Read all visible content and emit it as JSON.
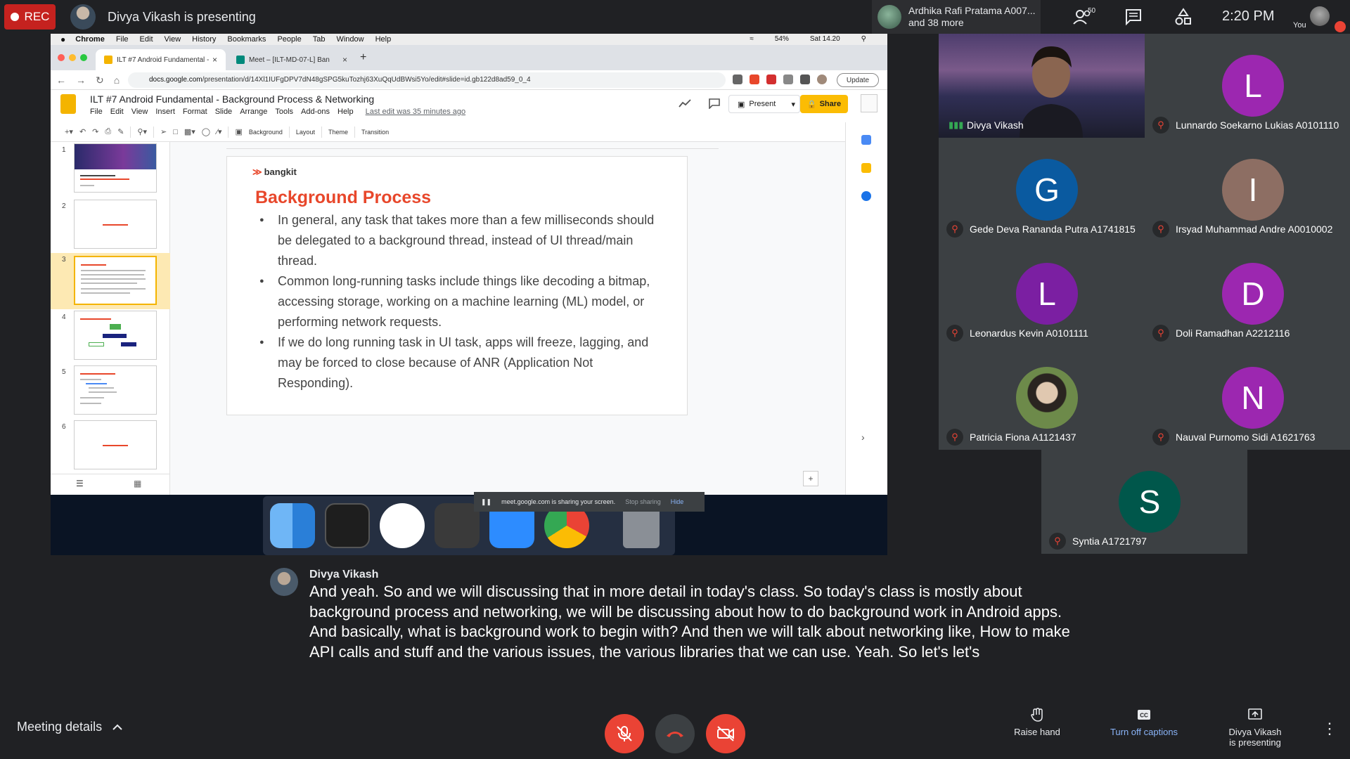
{
  "topbar": {
    "rec_label": "REC",
    "presenter_title": "Divya Vikash is presenting",
    "participant_pill_line1": "Ardhika Rafi Pratama A007...",
    "participant_pill_line2": "and 38 more",
    "people_count": "50",
    "clock": "2:20 PM",
    "self_label": "You"
  },
  "mac_menubar": {
    "app": "Chrome",
    "items": [
      "File",
      "Edit",
      "View",
      "History",
      "Bookmarks",
      "People",
      "Tab",
      "Window",
      "Help"
    ],
    "battery": "54%",
    "datetime": "Sat 14.20"
  },
  "browser": {
    "tabs": [
      {
        "label": "ILT #7 Android Fundamental -"
      },
      {
        "label": "Meet – [ILT-MD-07-L] Ban"
      }
    ],
    "url_host": "docs.google.com",
    "url_path": "/presentation/d/14Xl1IUFgDPV7dN48gSPG5kuTozhj63XuQqUdBWsi5Yo/edit#slide=id.gb122d8ad59_0_4",
    "update_label": "Update"
  },
  "slides_app": {
    "doc_title": "ILT #7 Android Fundamental - Background Process & Networking",
    "menu": [
      "File",
      "Edit",
      "View",
      "Insert",
      "Format",
      "Slide",
      "Arrange",
      "Tools",
      "Add-ons",
      "Help"
    ],
    "last_edit": "Last edit was 35 minutes ago",
    "present_label": "Present",
    "share_label": "Share",
    "toolbar": [
      "Background",
      "Layout",
      "Theme",
      "Transition"
    ],
    "thumbnails": [
      "1",
      "2",
      "3",
      "4",
      "5",
      "6"
    ],
    "selected_thumbnail": 3
  },
  "slide": {
    "logo_text": "bangkit",
    "title": "Background Process",
    "bullets": [
      "In general, any task that takes more than a few milliseconds should be delegated to a background thread, instead of UI thread/main thread.",
      "Common long-running tasks include things like decoding a bitmap, accessing storage, working on a machine learning (ML) model, or performing network requests.",
      "If we do long running task in UI task, apps will freeze, lagging, and may be forced to close because of ANR (Application Not Responding)."
    ],
    "title_color": "#e8472b"
  },
  "share_notice": {
    "text": "meet.google.com is sharing your screen.",
    "stop_label": "Stop sharing",
    "hide_label": "Hide"
  },
  "participants": [
    {
      "name": "Divya Vikash",
      "initial": "",
      "color": "",
      "video": true
    },
    {
      "name": "Lunnardo Soekarno Lukias A0101110",
      "initial": "L",
      "color": "#9c27b0"
    },
    {
      "name": "Gede Deva Rananda Putra A1741815",
      "initial": "G",
      "color": "#0a5aa0"
    },
    {
      "name": "Irsyad Muhammad Andre A0010002",
      "initial": "I",
      "color": "#8d6e63"
    },
    {
      "name": "Leonardus Kevin A0101111",
      "initial": "L",
      "color": "#7b1fa2"
    },
    {
      "name": "Doli Ramadhan A2212116",
      "initial": "D",
      "color": "#9c27b0"
    },
    {
      "name": "Patricia Fiona A1121437",
      "initial": "",
      "color": "#6d8a4a"
    },
    {
      "name": "Nauval Purnomo Sidi A1621763",
      "initial": "N",
      "color": "#9c27b0"
    },
    {
      "name": "Syntia A1721797",
      "initial": "S",
      "color": "#00574b"
    }
  ],
  "caption": {
    "speaker": "Divya Vikash",
    "text": "And yeah. So and we will discussing that in more detail in today's class. So today's class is mostly about background process and networking, we will be discussing about how to do background work in Android apps. And basically, what is background work to begin with? And then we will talk about networking like, How to make API calls and stuff and the various issues, the various libraries that we can use. Yeah. So let's let's"
  },
  "bottombar": {
    "meeting_details": "Meeting details",
    "raise_hand": "Raise hand",
    "captions": "Turn off captions",
    "presenting_line1": "Divya Vikash",
    "presenting_line2": "is presenting"
  },
  "colors": {
    "accent": "#8ab4f8",
    "danger": "#ea4335",
    "tile_bg": "#3c4043",
    "bar_bg": "#202124"
  }
}
